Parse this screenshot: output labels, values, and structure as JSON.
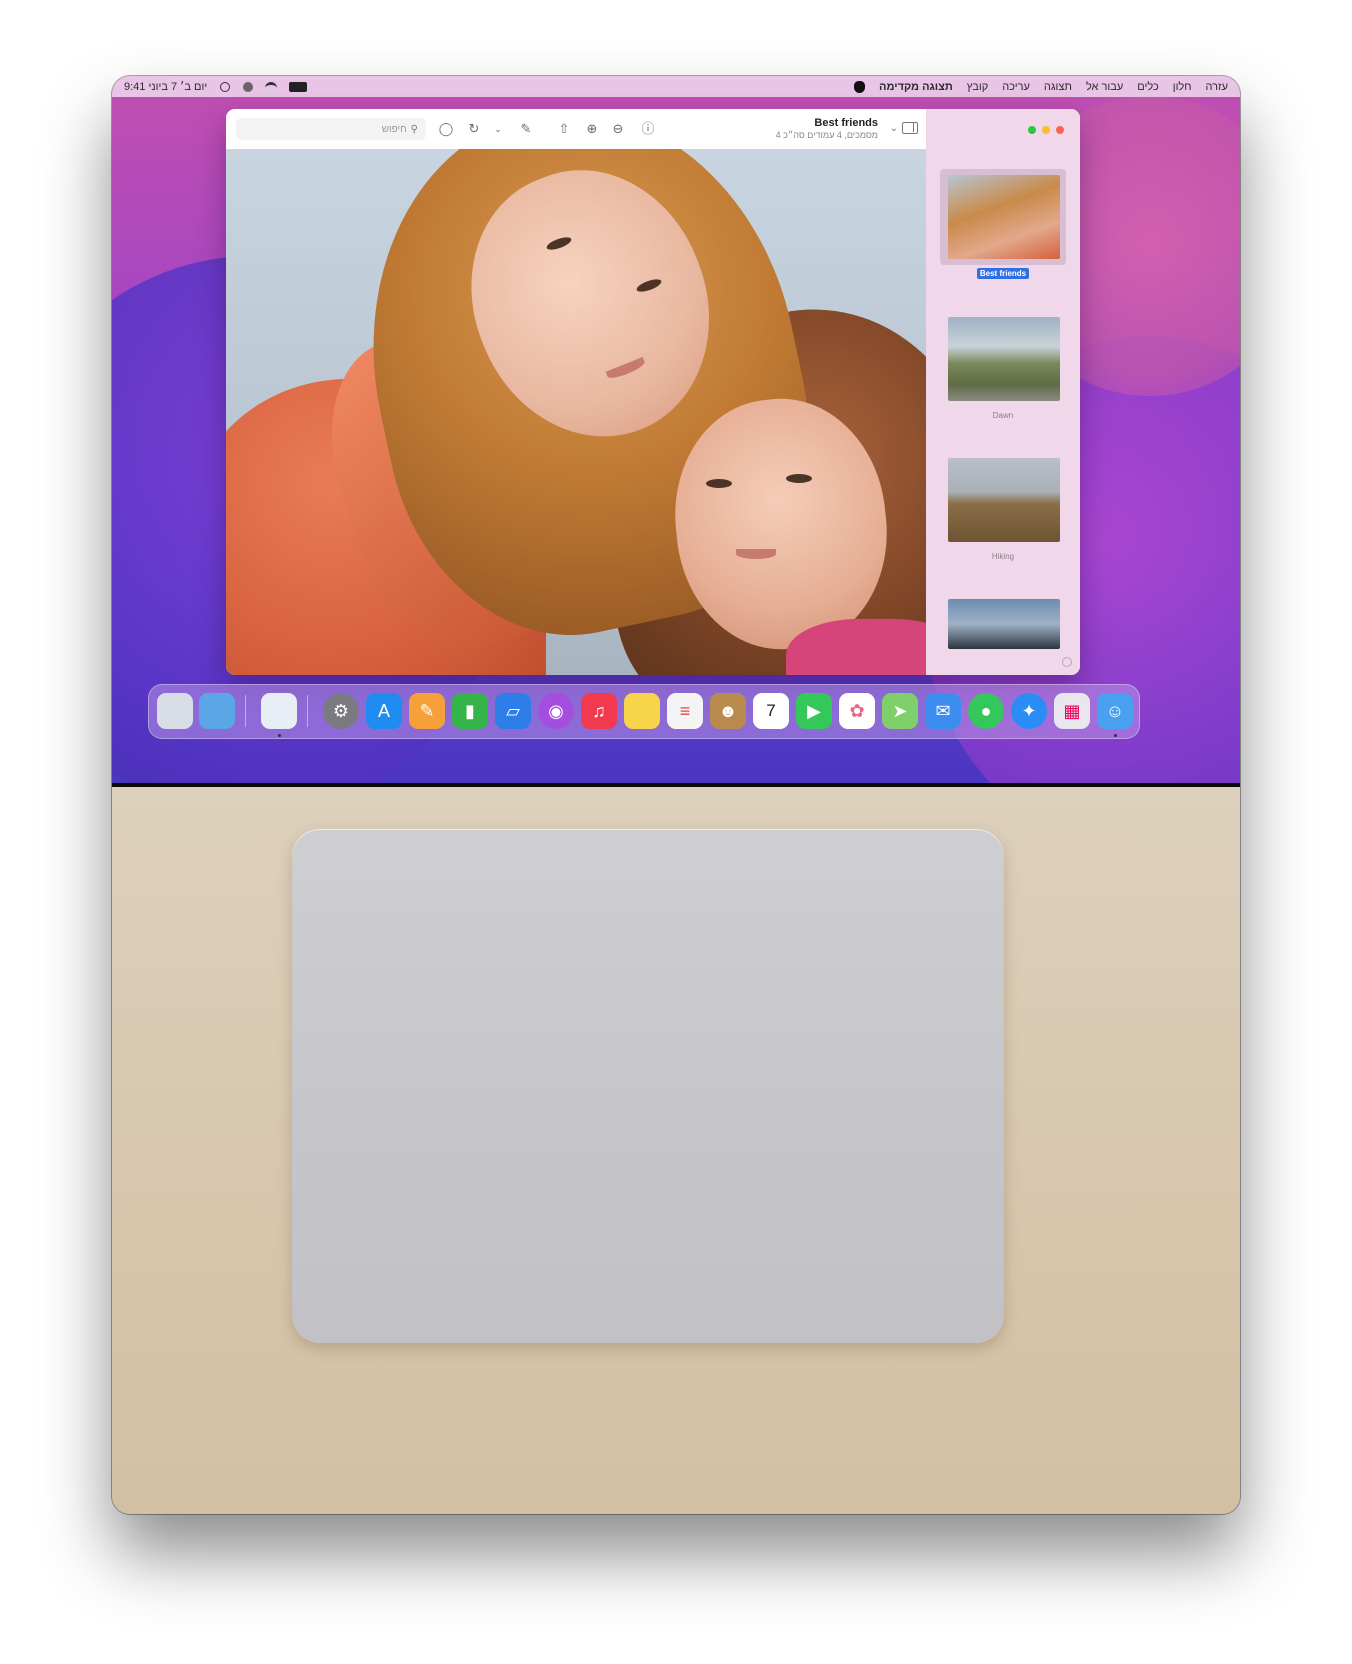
{
  "menubar": {
    "app_name": "תצוגה מקדימה",
    "menus": [
      "קובץ",
      "עריכה",
      "תצוגה",
      "עבור אל",
      "כלים",
      "חלון",
      "עזרה"
    ],
    "clock": "9:41 יום ב׳ 7 ביוני"
  },
  "preview": {
    "search_placeholder": "חיפוש",
    "document_title": "Best friends",
    "document_subtitle": "4 מסמכים, 4 עמודים סה״כ",
    "thumbnails": [
      {
        "label": "Best friends",
        "selected": true
      },
      {
        "label": "Dawn",
        "selected": false
      },
      {
        "label": "Hiking",
        "selected": false
      },
      {
        "label": "",
        "selected": false
      }
    ],
    "traffic_colors": {
      "close": "#ff5f57",
      "minimize": "#febc2e",
      "zoom": "#28c840"
    }
  },
  "dock": {
    "items": [
      {
        "icon": "trash-icon",
        "color": "#d9dde6"
      },
      {
        "icon": "downloads-folder-icon",
        "color": "#5aa6e6"
      },
      {
        "icon": "preview-icon",
        "color": "#e8eef5"
      },
      {
        "icon": "system-preferences-icon",
        "color": "#7a7a80"
      },
      {
        "icon": "app-store-icon",
        "color": "#1e8cf0"
      },
      {
        "icon": "pages-icon",
        "color": "#f6a03a"
      },
      {
        "icon": "numbers-icon",
        "color": "#35b44a"
      },
      {
        "icon": "keynote-icon",
        "color": "#2e7ee8"
      },
      {
        "icon": "podcasts-icon",
        "color": "#a44ee0"
      },
      {
        "icon": "music-icon",
        "color": "#f23a4e"
      },
      {
        "icon": "notes-icon",
        "color": "#f7d44a"
      },
      {
        "icon": "reminders-icon",
        "color": "#f4f4f4"
      },
      {
        "icon": "contacts-icon",
        "color": "#b98a4e"
      },
      {
        "icon": "calendar-icon",
        "color": "#ffffff"
      },
      {
        "icon": "facetime-icon",
        "color": "#34c759"
      },
      {
        "icon": "photos-icon",
        "color": "#ffffff"
      },
      {
        "icon": "maps-icon",
        "color": "#7fcf6a"
      },
      {
        "icon": "mail-icon",
        "color": "#3b8ef0"
      },
      {
        "icon": "messages-icon",
        "color": "#34c759"
      },
      {
        "icon": "safari-icon",
        "color": "#2a8df5"
      },
      {
        "icon": "launchpad-icon",
        "color": "#e9e6ef"
      },
      {
        "icon": "finder-icon",
        "color": "#4aa0f0"
      }
    ],
    "calendar_day": "7"
  }
}
